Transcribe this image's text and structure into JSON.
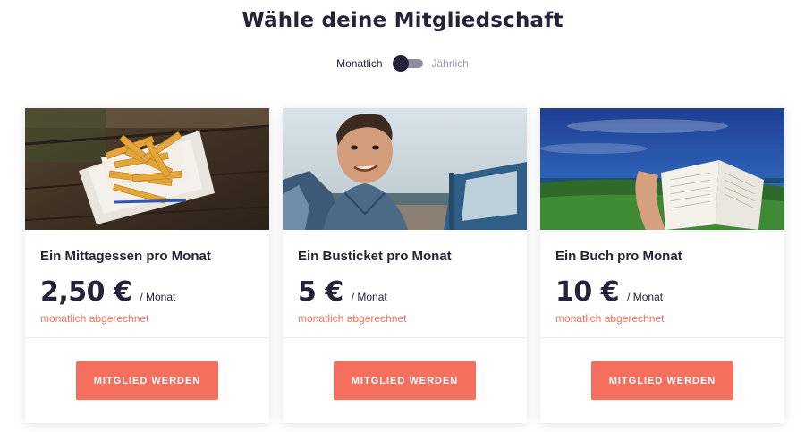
{
  "page": {
    "title": "Wähle deine Mitgliedschaft"
  },
  "billing_toggle": {
    "left_label": "Monatlich",
    "right_label": "Jährlich",
    "selected": "Monatlich"
  },
  "plans": [
    {
      "title": "Ein Mittagessen pro Monat",
      "price": "2,50 €",
      "period": "/ Monat",
      "note": "monatlich abgerechnet",
      "button_label": "MITGLIED WERDEN",
      "image_subject": "fries"
    },
    {
      "title": "Ein Busticket pro Monat",
      "price": "5 €",
      "period": "/ Monat",
      "note": "monatlich abgerechnet",
      "button_label": "MITGLIED WERDEN",
      "image_subject": "man-selfie-beach"
    },
    {
      "title": "Ein Buch pro Monat",
      "price": "10 €",
      "period": "/ Monat",
      "note": "monatlich abgerechnet",
      "button_label": "MITGLIED WERDEN",
      "image_subject": "open-book-landscape"
    }
  ],
  "colors": {
    "text_dark": "#27213a",
    "accent": "#f56f5e",
    "note": "#f0745f",
    "muted": "#9a97a8"
  }
}
